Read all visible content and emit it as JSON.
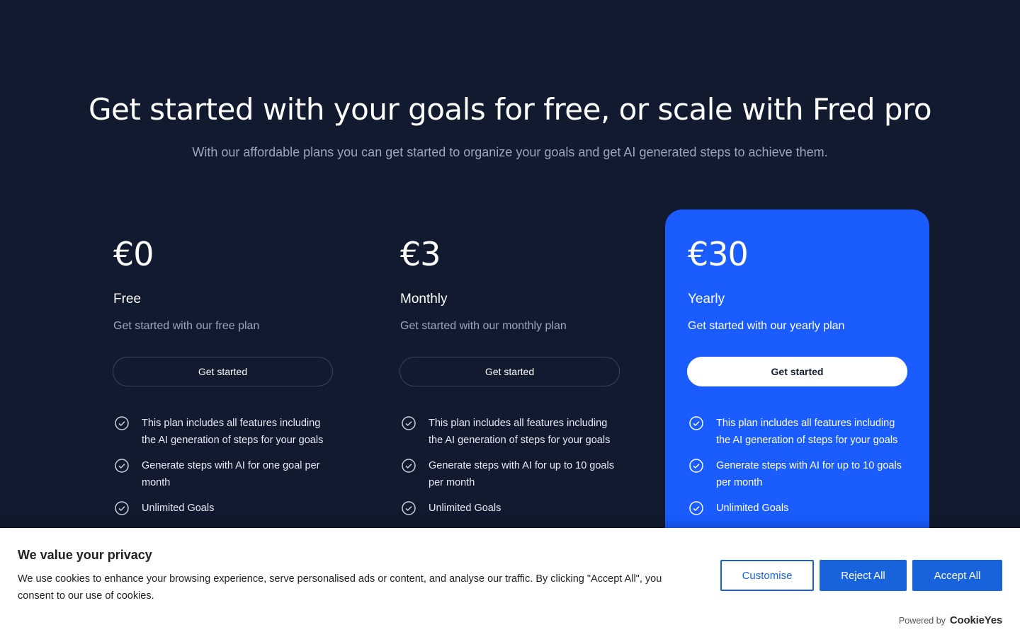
{
  "hero": {
    "title": "Get started with your goals for free, or scale with Fred pro",
    "subtitle": "With our affordable plans you can get started to organize your goals and get AI generated steps to achieve them."
  },
  "plans": [
    {
      "price": "€0",
      "name": "Free",
      "description": "Get started with our free plan",
      "cta": "Get started",
      "features": [
        "This plan includes all features including the AI generation of steps for your goals",
        "Generate steps with AI for one goal per month",
        "Unlimited Goals"
      ]
    },
    {
      "price": "€3",
      "name": "Monthly",
      "description": "Get started with our monthly plan",
      "cta": "Get started",
      "features": [
        "This plan includes all features including the AI generation of steps for your goals",
        "Generate steps with AI for up to 10 goals per month",
        "Unlimited Goals"
      ]
    },
    {
      "price": "€30",
      "name": "Yearly",
      "description": "Get started with our yearly plan",
      "cta": "Get started",
      "highlighted": true,
      "features": [
        "This plan includes all features including the AI generation of steps for your goals",
        "Generate steps with AI for up to 10 goals per month",
        "Unlimited Goals"
      ]
    }
  ],
  "cookie_banner": {
    "title": "We value your privacy",
    "text": "We use cookies to enhance your browsing experience, serve personalised ads or content, and analyse our traffic. By clicking \"Accept All\", you consent to our use of cookies.",
    "customise_label": "Customise",
    "reject_label": "Reject All",
    "accept_label": "Accept All",
    "powered_by": "Powered by",
    "brand": "CookieYes"
  },
  "colors": {
    "background": "#111a2e",
    "highlight": "#1a5cff",
    "cookie_accent": "#1863dc"
  },
  "icons": {
    "feature": "check-circle-icon"
  }
}
